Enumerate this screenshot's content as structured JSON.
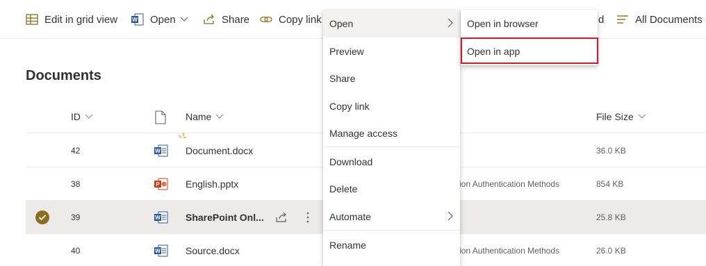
{
  "toolbar": {
    "edit_grid": "Edit in grid view",
    "open": "Open",
    "share": "Share",
    "copy_link": "Copy link",
    "partial_right": "d",
    "all_documents": "All Documents"
  },
  "page": {
    "title": "Documents"
  },
  "columns": {
    "id": "ID",
    "name": "Name",
    "file_size": "File Size"
  },
  "rows": [
    {
      "id": "42",
      "name": "Document.docx",
      "modified": "",
      "size": "36.0 KB",
      "type": "word",
      "selected": false
    },
    {
      "id": "38",
      "name": "English.pptx",
      "modified": "ation Authentication Methods",
      "size": "854 KB",
      "type": "ppt",
      "selected": false
    },
    {
      "id": "39",
      "name": "SharePoint Onl...",
      "modified": "",
      "size": "25.8 KB",
      "type": "word",
      "selected": true
    },
    {
      "id": "40",
      "name": "Source.docx",
      "modified": "ation Authentication Methods",
      "size": "26.0 KB",
      "type": "word",
      "selected": false
    }
  ],
  "menu": {
    "items": [
      {
        "label": "Open"
      },
      {
        "label": "Preview"
      },
      {
        "label": "Share"
      },
      {
        "label": "Copy link"
      },
      {
        "label": "Manage access"
      },
      {
        "label": "Download"
      },
      {
        "label": "Delete"
      },
      {
        "label": "Automate"
      },
      {
        "label": "Rename"
      }
    ]
  },
  "submenu": {
    "items": [
      {
        "label": "Open in browser"
      },
      {
        "label": "Open in app"
      }
    ]
  },
  "colors": {
    "accent": "#8a6d1d",
    "word": "#2b579a",
    "ppt": "#c43e1c",
    "highlight": "#e81123"
  }
}
